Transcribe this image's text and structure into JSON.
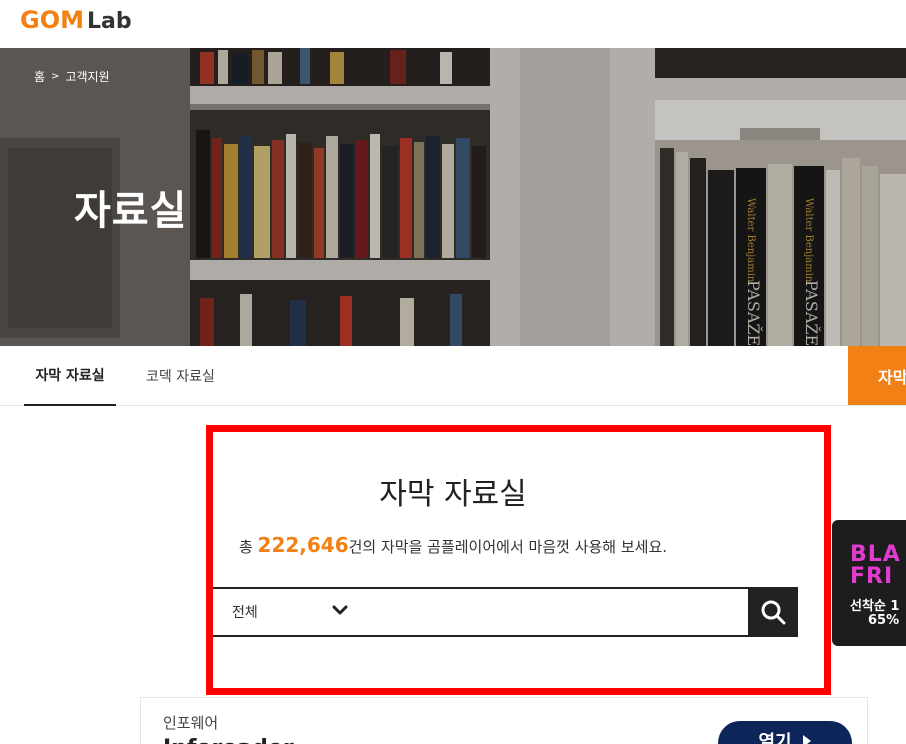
{
  "header": {
    "logo_gom": "GOM",
    "logo_lab": "Lab"
  },
  "hero": {
    "breadcrumb": [
      "홈",
      "고객지원"
    ],
    "breadcrumb_sep": ">",
    "title": "자료실",
    "book_text": [
      "Walter Benjamin",
      "Walter Benjamin",
      "PASAŽE",
      "PASAŽE"
    ]
  },
  "tabs": [
    {
      "label": "자막 자료실",
      "active": true
    },
    {
      "label": "코덱 자료실",
      "active": false
    }
  ],
  "orange_cta": {
    "label": "자막"
  },
  "main": {
    "title": "자막 자료실",
    "count_prefix": "총 ",
    "count": "222,646",
    "count_suffix": "건의 자막을 곰플레이어에서 마음껏 사용해 보세요.",
    "search": {
      "category_selected": "전체",
      "input_value": "",
      "icon": "search-icon"
    }
  },
  "side_banner": {
    "line1": "BLA",
    "line2": "FRI",
    "text1": "선착순 1",
    "text2": "65%"
  },
  "card": {
    "label": "인포웨어",
    "name": "Inforeader",
    "button_label": "열기"
  },
  "colors": {
    "brand_orange": "#f28014",
    "highlight_red": "#ff0000",
    "search_button": "#222222",
    "open_button": "#0d2558"
  }
}
